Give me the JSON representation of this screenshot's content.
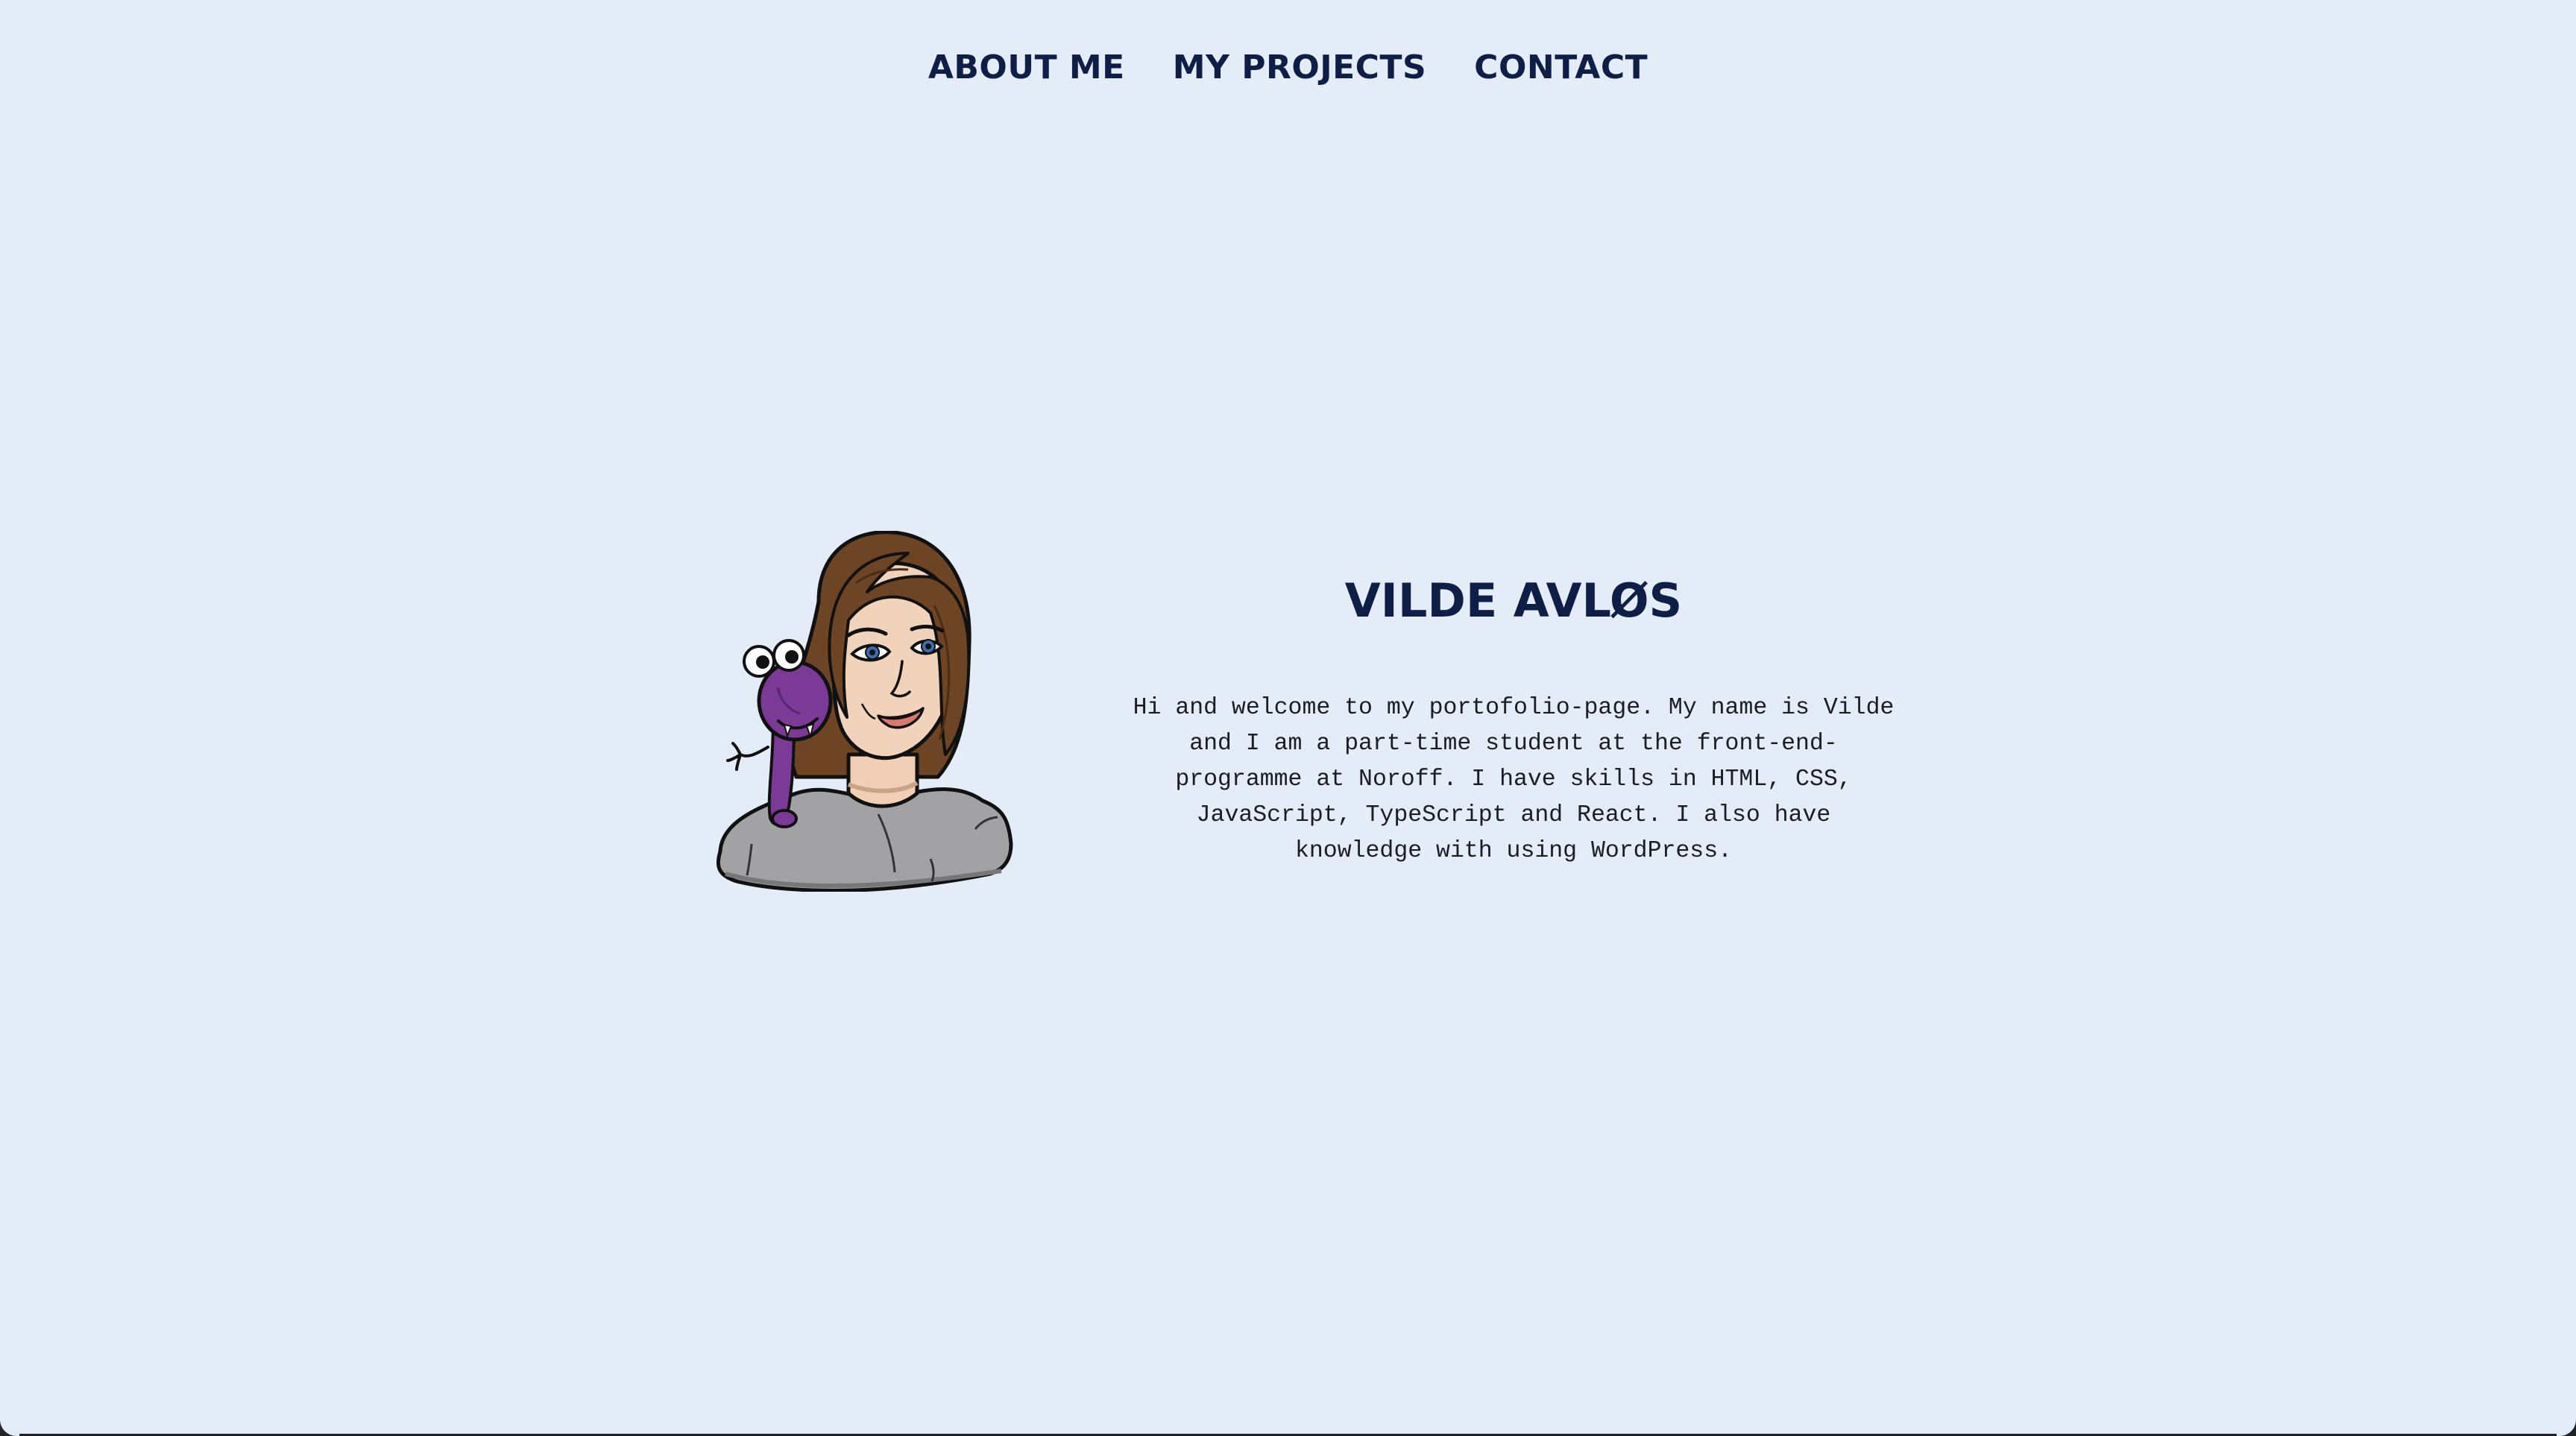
{
  "nav": {
    "items": [
      {
        "label": "ABOUT ME"
      },
      {
        "label": "MY PROJECTS"
      },
      {
        "label": "CONTACT"
      }
    ]
  },
  "hero": {
    "name": "VILDE AVLØS",
    "bio": "Hi and welcome to my portofolio-page. My name is Vilde and I am a part-time student at the front-end-programme at Noroff. I have skills in HTML, CSS, JavaScript, TypeScript and React. I also have knowledge with using WordPress."
  },
  "colors": {
    "background": "#e4ecf8",
    "heading": "#0f1e46",
    "body_text": "#1c1c24"
  }
}
